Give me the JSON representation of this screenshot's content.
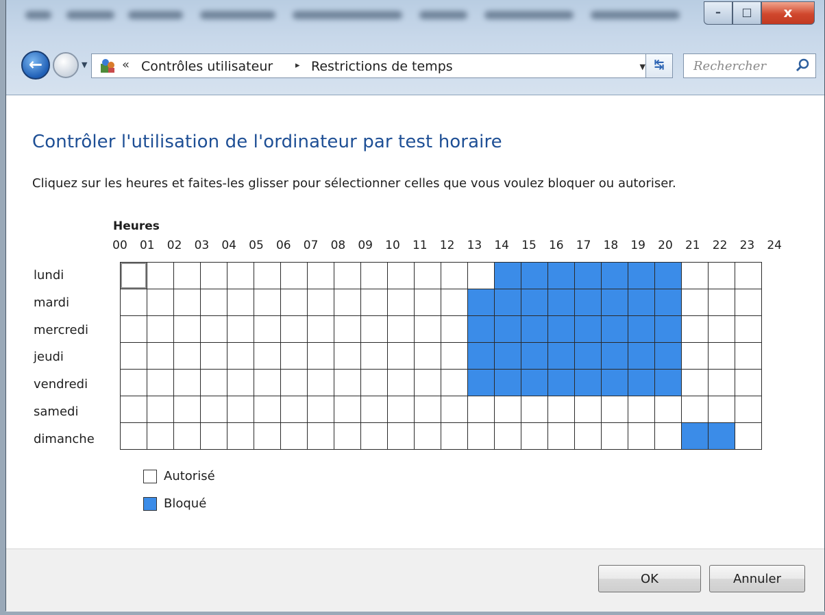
{
  "navigation": {
    "breadcrumb_overflow": "«",
    "breadcrumbs": [
      "Contrôles utilisateur",
      "Restrictions de temps"
    ],
    "breadcrumb_separator": "▸",
    "search_placeholder": "Rechercher"
  },
  "page": {
    "title": "Contrôler l'utilisation de l'ordinateur par test horaire",
    "instruction": "Cliquez sur les heures et faites-les glisser pour sélectionner celles que vous voulez bloquer ou autoriser."
  },
  "schedule": {
    "hours_label": "Heures",
    "hour_ticks": [
      "00",
      "01",
      "02",
      "03",
      "04",
      "05",
      "06",
      "07",
      "08",
      "09",
      "10",
      "11",
      "12",
      "13",
      "14",
      "15",
      "16",
      "17",
      "18",
      "19",
      "20",
      "21",
      "22",
      "23",
      "24"
    ],
    "days": [
      {
        "name": "lundi",
        "blocked_hours": [
          14,
          15,
          16,
          17,
          18,
          19,
          20
        ]
      },
      {
        "name": "mardi",
        "blocked_hours": [
          13,
          14,
          15,
          16,
          17,
          18,
          19,
          20
        ]
      },
      {
        "name": "mercredi",
        "blocked_hours": [
          13,
          14,
          15,
          16,
          17,
          18,
          19,
          20
        ]
      },
      {
        "name": "jeudi",
        "blocked_hours": [
          13,
          14,
          15,
          16,
          17,
          18,
          19,
          20
        ]
      },
      {
        "name": "vendredi",
        "blocked_hours": [
          13,
          14,
          15,
          16,
          17,
          18,
          19,
          20
        ]
      },
      {
        "name": "samedi",
        "blocked_hours": []
      },
      {
        "name": "dimanche",
        "blocked_hours": [
          21,
          22
        ]
      }
    ],
    "focused_cell": {
      "day": "lundi",
      "hour": 0
    },
    "colors": {
      "allowed": "#ffffff",
      "blocked": "#3b8ce8"
    }
  },
  "legend": {
    "allowed": "Autorisé",
    "blocked": "Bloqué"
  },
  "buttons": {
    "ok": "OK",
    "cancel": "Annuler"
  },
  "window_controls": {
    "minimize": "–",
    "maximize": "□",
    "close": "x"
  }
}
